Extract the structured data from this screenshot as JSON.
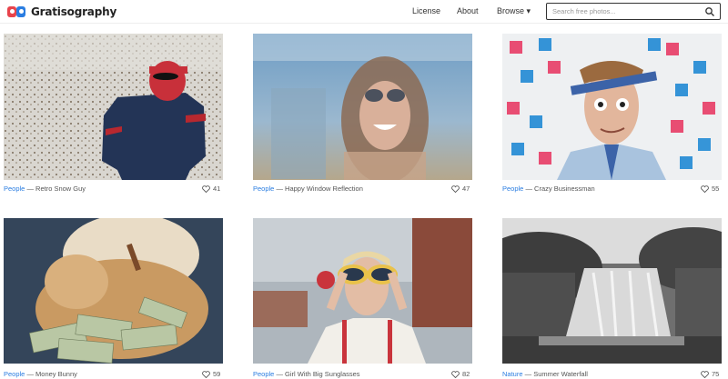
{
  "header": {
    "logo_text": "Gratisography",
    "nav": [
      {
        "label": "License"
      },
      {
        "label": "About"
      },
      {
        "label": "Browse ▾"
      }
    ],
    "search_placeholder": "Search free photos..."
  },
  "photos": [
    {
      "category": "People",
      "title": "Retro Snow Guy",
      "likes": "41"
    },
    {
      "category": "People",
      "title": "Happy Window Reflection",
      "likes": "47"
    },
    {
      "category": "People",
      "title": "Crazy Businessman",
      "likes": "55"
    },
    {
      "category": "People",
      "title": "Money Bunny",
      "likes": "59"
    },
    {
      "category": "People",
      "title": "Girl With Big Sunglasses",
      "likes": "82"
    },
    {
      "category": "Nature",
      "title": "Summer Waterfall",
      "likes": "75"
    }
  ],
  "separator": " — ",
  "colors": {
    "link": "#2a7de1",
    "logo_red": "#e8434b",
    "logo_blue": "#2a7de1"
  }
}
